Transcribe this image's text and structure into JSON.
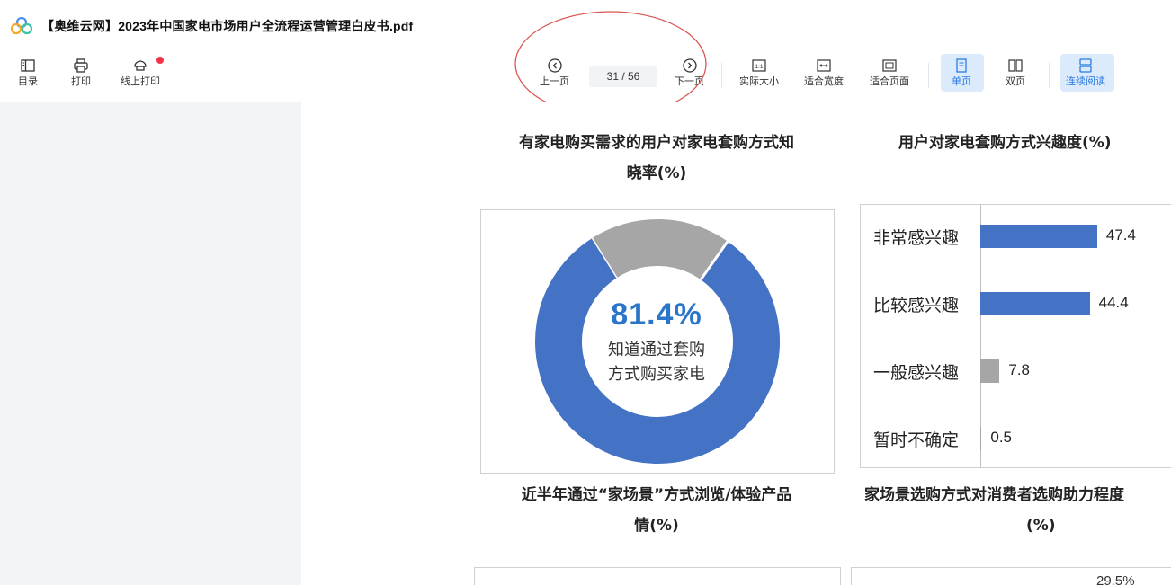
{
  "app": {
    "doc_title": "【奥维云网】2023年中国家电市场用户全流程运营管理白皮书.pdf"
  },
  "toolbar": {
    "toc": "目录",
    "print": "打印",
    "online_print": "线上打印",
    "prev_page": "上一页",
    "page_indicator": "31 / 56",
    "next_page": "下一页",
    "actual_size": "实际大小",
    "fit_width": "适合宽度",
    "fit_page": "适合页面",
    "single_page": "单页",
    "double_page": "双页",
    "continuous": "连续阅读",
    "actual_size_icon_text": "1:1"
  },
  "colors": {
    "accent_blue": "#2a7ae2",
    "highlight_bg": "#dcebfc",
    "donut_blue": "#4472c4",
    "donut_gray": "#a6a6a6",
    "annotation_red": "#d9534f",
    "notif_dot": "#f2334a"
  },
  "page": {
    "chart1_title_line1": "有家电购买需求的用户对家电套购方式知",
    "chart1_title_line2": "晓率(%)",
    "chart2_title": "用户对家电套购方式兴趣度(%)",
    "chart3_title_line1": "近半年通过“家场景”方式浏览/体验产品",
    "chart3_title_line2": "情(%)",
    "chart4_title_line1": "家场景选购方式对消费者选购助力程度",
    "chart4_title_line2": "(%)",
    "chart4_partial_value": "29.5%"
  },
  "chart_data": [
    {
      "type": "pie",
      "title": "有家电购买需求的用户对家电套购方式知晓率(%)",
      "values": [
        81.4,
        18.6
      ],
      "center_value": "81.4%",
      "center_text_line1": "知道通过套购",
      "center_text_line2": "方式购买家电"
    },
    {
      "type": "bar",
      "orientation": "horizontal",
      "title": "用户对家电套购方式兴趣度(%)",
      "categories": [
        "非常感兴趣",
        "比较感兴趣",
        "一般感兴趣",
        "暂时不确定"
      ],
      "values": [
        47.4,
        44.4,
        7.8,
        0.5
      ],
      "value_labels": [
        "47.4",
        "44.4",
        "7.8",
        "0.5"
      ],
      "bar_colors": [
        "#4472c4",
        "#4472c4",
        "#a6a6a6",
        "#a6a6a6"
      ],
      "xlim": [
        0,
        50
      ]
    }
  ]
}
